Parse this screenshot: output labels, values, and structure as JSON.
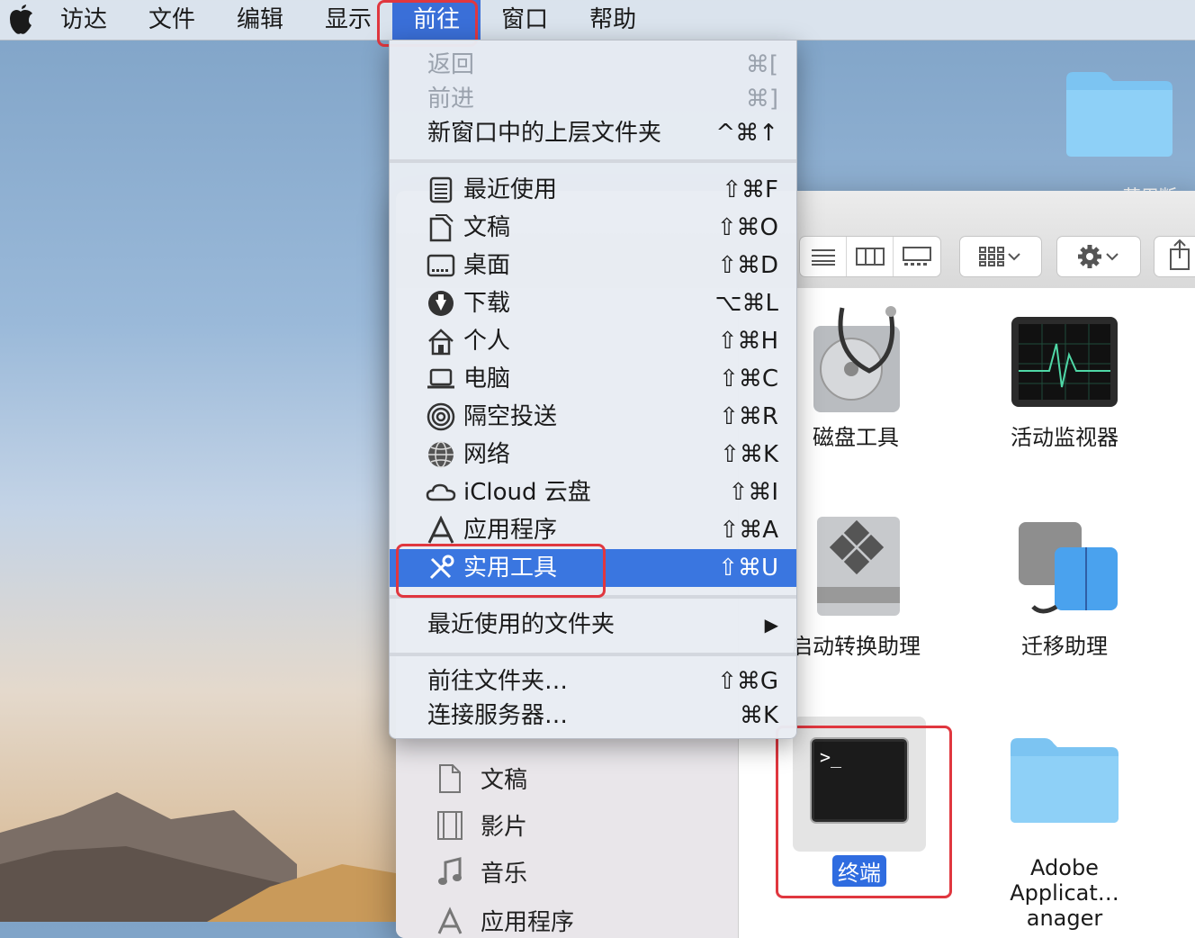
{
  "menubar": {
    "items": [
      "访达",
      "文件",
      "编辑",
      "显示",
      "前往",
      "窗口",
      "帮助"
    ],
    "active_index": 4
  },
  "desktop": {
    "folder_label": "… … …范用断"
  },
  "go_menu": {
    "top_items": [
      {
        "label": "返回",
        "shortcut": "⌘[",
        "disabled": true
      },
      {
        "label": "前进",
        "shortcut": "⌘]",
        "disabled": true
      },
      {
        "label": "新窗口中的上层文件夹",
        "shortcut": "^⌘↑",
        "disabled": false
      }
    ],
    "places": [
      {
        "label": "最近使用",
        "shortcut": "⇧⌘F",
        "icon": "recents-icon"
      },
      {
        "label": "文稿",
        "shortcut": "⇧⌘O",
        "icon": "documents-icon"
      },
      {
        "label": "桌面",
        "shortcut": "⇧⌘D",
        "icon": "desktop-icon"
      },
      {
        "label": "下载",
        "shortcut": "⌥⌘L",
        "icon": "downloads-icon"
      },
      {
        "label": "个人",
        "shortcut": "⇧⌘H",
        "icon": "home-icon"
      },
      {
        "label": "电脑",
        "shortcut": "⇧⌘C",
        "icon": "computer-icon"
      },
      {
        "label": "隔空投送",
        "shortcut": "⇧⌘R",
        "icon": "airdrop-icon"
      },
      {
        "label": "网络",
        "shortcut": "⇧⌘K",
        "icon": "network-icon"
      },
      {
        "label": "iCloud 云盘",
        "shortcut": "⇧⌘I",
        "icon": "icloud-icon"
      },
      {
        "label": "应用程序",
        "shortcut": "⇧⌘A",
        "icon": "applications-icon"
      },
      {
        "label": "实用工具",
        "shortcut": "⇧⌘U",
        "icon": "utilities-icon",
        "selected": true
      }
    ],
    "recent_folders": {
      "label": "最近使用的文件夹",
      "submenu_arrow": "▶"
    },
    "bottom_items": [
      {
        "label": "前往文件夹…",
        "shortcut": "⇧⌘G"
      },
      {
        "label": "连接服务器…",
        "shortcut": "⌘K"
      }
    ]
  },
  "finder": {
    "sidebar": [
      {
        "label": "文稿",
        "icon": "documents-icon"
      },
      {
        "label": "影片",
        "icon": "movies-icon"
      },
      {
        "label": "音乐",
        "icon": "music-icon"
      },
      {
        "label": "应用程序",
        "icon": "applications-icon"
      }
    ],
    "apps": [
      {
        "label": "磁盘工具",
        "icon": "disk-utility-icon"
      },
      {
        "label": "活动监视器",
        "icon": "activity-monitor-icon"
      },
      {
        "label": "启动转换助理",
        "icon": "boot-camp-icon"
      },
      {
        "label": "迁移助理",
        "icon": "migration-assistant-icon"
      },
      {
        "label": "终端",
        "icon": "terminal-icon",
        "selected": true
      },
      {
        "label": "Adobe",
        "label2": "Applicat…anager",
        "icon": "folder-icon"
      }
    ],
    "terminal_prompt": ">_"
  },
  "colors": {
    "accent": "#3a76e0",
    "highlight_box": "#e0373f"
  }
}
